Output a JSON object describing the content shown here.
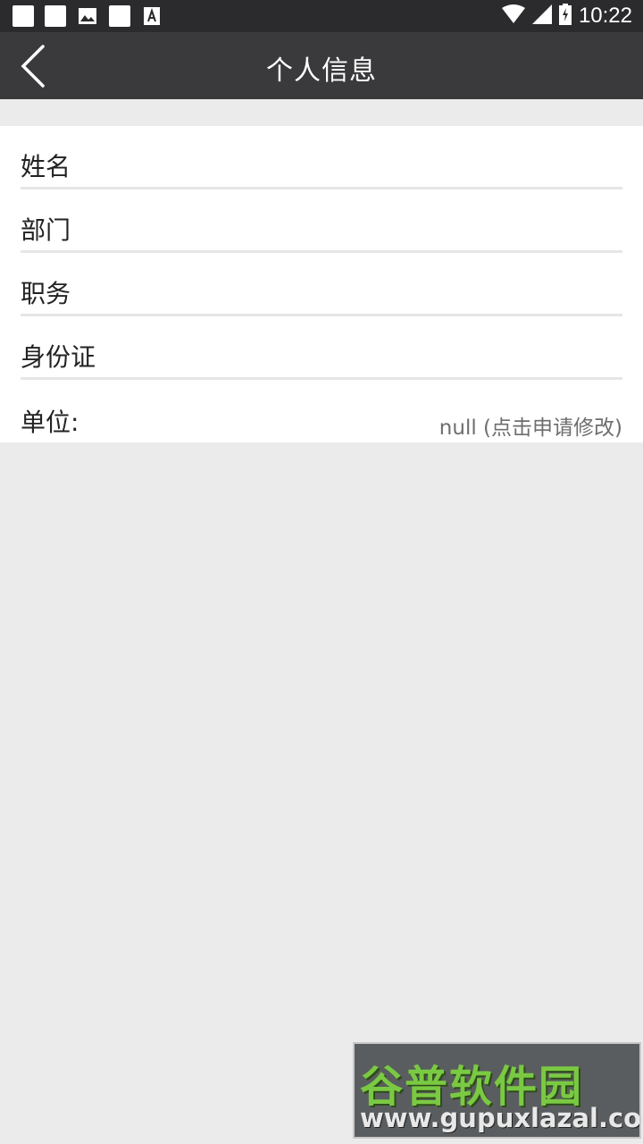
{
  "status_bar": {
    "time": "10:22",
    "left_icons": [
      "notification-square-icon",
      "notification-square-icon",
      "image-icon",
      "notification-square-icon",
      "text-a-icon"
    ],
    "right_icons": [
      "wifi-icon",
      "signal-icon",
      "battery-charging-icon"
    ]
  },
  "app_bar": {
    "title": "个人信息",
    "back_icon": "chevron-left-icon"
  },
  "profile": {
    "fields": [
      {
        "label": "姓名",
        "value": ""
      },
      {
        "label": "部门",
        "value": ""
      },
      {
        "label": "职务",
        "value": ""
      },
      {
        "label": "身份证",
        "value": ""
      },
      {
        "label": "单位:",
        "value": "null (点击申请修改)"
      }
    ]
  },
  "watermark": {
    "main": "谷普软件园",
    "sub": "www.gupuxlazal.com"
  },
  "colors": {
    "status_bar": "#2b2b2d",
    "app_bar": "#3a3a3c",
    "background": "#ebebeb",
    "card": "#ffffff",
    "divider": "#e6e6e6",
    "watermark_green": "#7ac943"
  }
}
